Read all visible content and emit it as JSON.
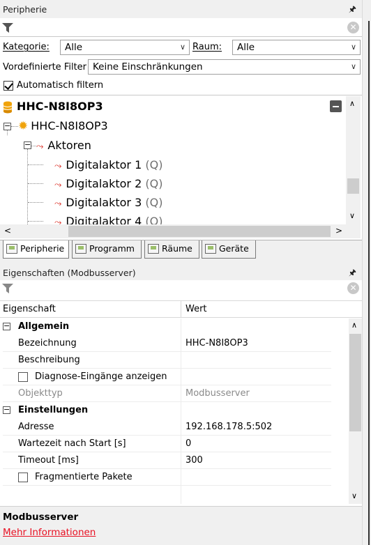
{
  "peripherie_panel": {
    "title": "Peripherie",
    "pin_icon": "pin-icon",
    "kategorie_label": "Kategorie:",
    "kategorie_value": "Alle",
    "raum_label": "Raum:",
    "raum_value": "Alle",
    "vordefinierte_label": "Vordefinierte Filter",
    "vordefinierte_value": "Keine Einschränkungen",
    "auto_filter_label": "Automatisch filtern",
    "auto_filter_checked": true
  },
  "tree": {
    "root": "HHC-N8I8OP3",
    "device": "HHC-N8I8OP3",
    "group": "Aktoren",
    "items": [
      {
        "label": "Digitalaktor 1",
        "suffix": "(Q)"
      },
      {
        "label": "Digitalaktor 2",
        "suffix": "(Q)"
      },
      {
        "label": "Digitalaktor 3",
        "suffix": "(Q)"
      },
      {
        "label": "Digitalaktor 4",
        "suffix": "(Q)"
      }
    ]
  },
  "tabs": [
    "Peripherie",
    "Programm",
    "Räume",
    "Geräte"
  ],
  "properties_panel": {
    "title": "Eigenschaften (Modbusserver)",
    "col_name": "Eigenschaft",
    "col_value": "Wert",
    "categories": [
      {
        "name": "Allgemein",
        "rows": [
          {
            "name": "Bezeichnung",
            "value": "HHC-N8I8OP3"
          },
          {
            "name": "Beschreibung",
            "value": ""
          },
          {
            "name": "Diagnose-Eingänge anzeigen",
            "value": "",
            "checkbox": true
          },
          {
            "name": "Objekttyp",
            "value": "Modbusserver",
            "disabled": true
          }
        ]
      },
      {
        "name": "Einstellungen",
        "rows": [
          {
            "name": "Adresse",
            "value": "192.168.178.5:502"
          },
          {
            "name": "Wartezeit nach Start [s]",
            "value": "0"
          },
          {
            "name": "Timeout [ms]",
            "value": "300"
          },
          {
            "name": "Fragmentierte Pakete",
            "value": "",
            "checkbox": true
          }
        ]
      }
    ]
  },
  "info": {
    "title": "Modbusserver",
    "link": "Mehr Informationen"
  },
  "colors": {
    "link": "#e81123",
    "root_icon": "#f0a30a",
    "actor_icon": "#d9261c",
    "disabled_text": "#8a8a8a",
    "suffix_text": "#707070"
  }
}
